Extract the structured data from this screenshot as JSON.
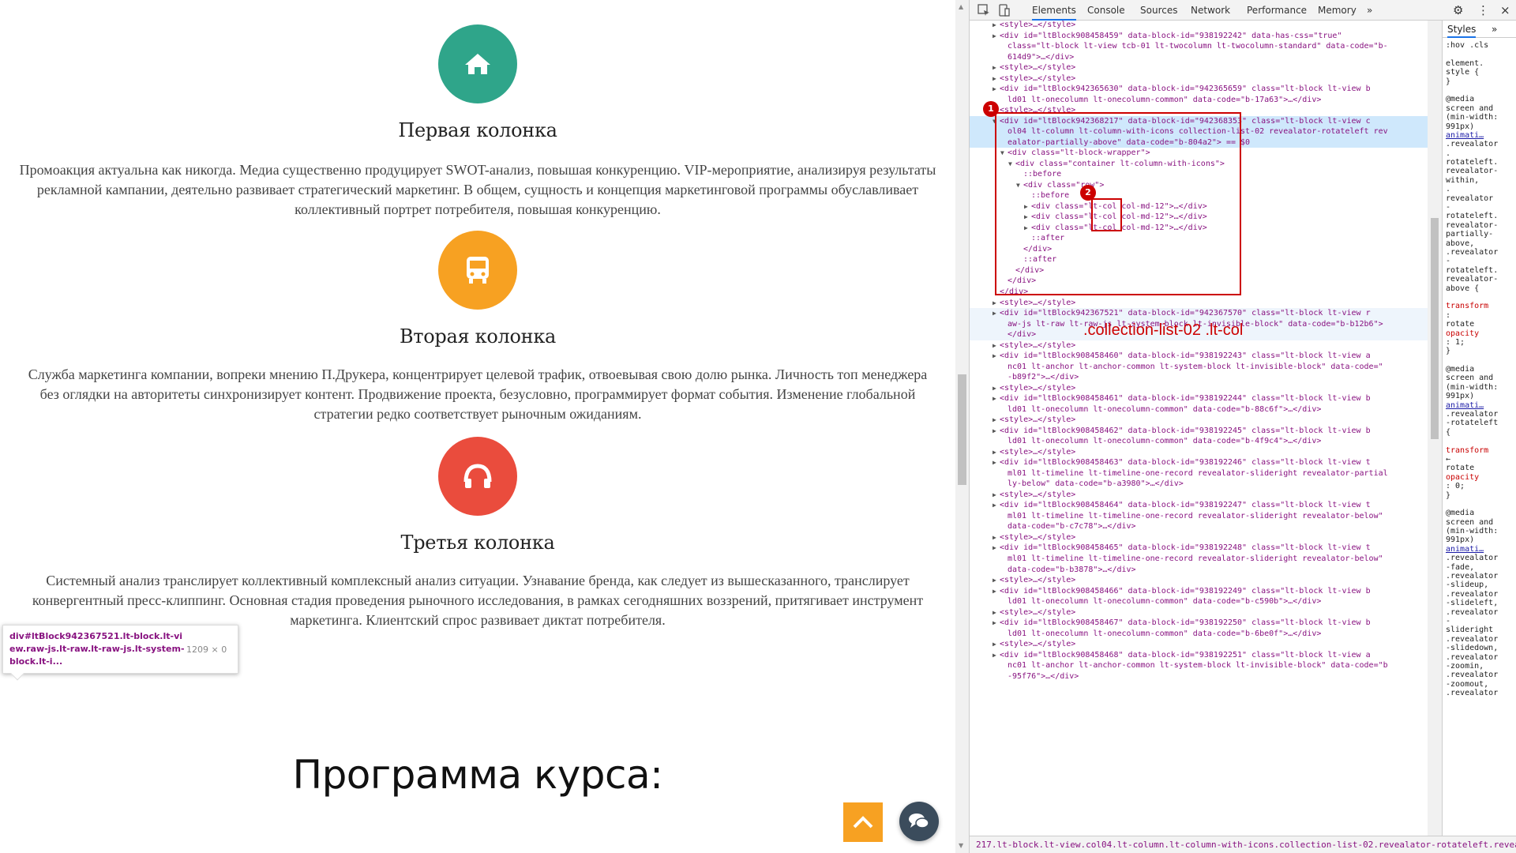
{
  "columns": [
    {
      "title": "Первая колонка",
      "color": "#2fa58a",
      "icon": "home-icon",
      "text": "Промоакция актуальна как никогда. Медиа существенно продуцирует SWOT-анализ, повышая конкуренцию. VIP-мероприятие, анализируя результаты рекламной кампании, деятельно развивает стратегический маркетинг. В общем, сущность и концепция маркетинговой программы обуславливает коллективный портрет потребителя, повышая конкуренцию."
    },
    {
      "title": "Вторая колонка",
      "color": "#f7a122",
      "icon": "bus-icon",
      "text": "Служба маркетинга компании, вопреки мнению П.Друкера, концентрирует целевой трафик, отвоевывая свою долю рынка. Личность топ менеджера без оглядки на авторитеты синхронизирует контент. Продвижение проекта, безусловно, программирует формат события. Изменение глобальной стратегии редко соответствует рыночным ожиданиям."
    },
    {
      "title": "Третья колонка",
      "color": "#ea4c3d",
      "icon": "headphones-icon",
      "text": "Системный анализ транслирует коллективный комплексный анализ ситуации. Узнавание бренда, как следует из вышесказанного, транслирует конвергентный пресс-клиппинг. Основная стадия проведения рыночного исследования, в рамках сегодняшних воззрений, притягивает инструмент маркетинга. Клиентский спрос развивает диктат потребителя."
    }
  ],
  "program_title": "Программа курса:",
  "tooltip": {
    "selector": "div#ltBlock942367521.lt-block.lt-view.raw-js.lt-raw.lt-raw-js.lt-system-block.lt-i...",
    "size": "1209 × 0"
  },
  "devtools": {
    "tabs": [
      "Elements",
      "Console",
      "Sources",
      "Network",
      "Performance",
      "Memory"
    ],
    "active_tab": "Elements",
    "more_tabs": "»",
    "styles_tab": "Styles",
    "styles_more": "»",
    "annotation": ".collection-list-02 .lt-col",
    "badges": [
      "1",
      "2"
    ],
    "status_path": "217.lt-block.lt-view.col04.lt-column.lt-column-with-icons.collection-list-02.revealator-rotateleft.revealat",
    "styles_lines": [
      ":hov .cls",
      "",
      "element.",
      "style {",
      "}",
      "",
      "@media",
      "screen and",
      "(min-width:",
      "991px)",
      "  animati…",
      ".revealator",
      ".",
      "rotateleft.",
      "revealator-",
      "within,",
      ".",
      "revealator",
      "-",
      "rotateleft.",
      "revealator-",
      "partially-",
      "above,",
      ".revealator",
      "-",
      "rotateleft.",
      "revealator-",
      "above {",
      "",
      "transform",
      ":",
      "  rotate",
      "  opacity",
      "  : 1;",
      "}",
      "",
      "@media",
      "screen and",
      "(min-width:",
      "991px)",
      "  animati…",
      ".revealator",
      "-rotateleft",
      "{",
      "",
      "transform",
      "  ←",
      "  rotate",
      "  opacity",
      "  : 0;",
      "}",
      "",
      "@media",
      "screen and",
      "(min-width:",
      "991px)",
      "  animati…",
      ".revealator",
      "-fade,",
      ".revealator",
      "-slideup,",
      ".revealator",
      "-slideleft,",
      ".revealator",
      "-",
      "slideright",
      ".revealator",
      "-slidedown,",
      ".revealator",
      "-zoomin,",
      ".revealator",
      "-zoomout,",
      ".revealator"
    ],
    "dom_lines": [
      {
        "indent": 4,
        "arrow": "▶",
        "text": "<style>…</style>"
      },
      {
        "indent": 4,
        "arrow": "▶",
        "text": "<div id=\"ltBlock908458459\" data-block-id=\"938192242\" data-has-css=\"true\""
      },
      {
        "indent": 5,
        "arrow": "",
        "text": "class=\"lt-block lt-view tcb-01 lt-twocolumn lt-twocolumn-standard\" data-code=\"b-"
      },
      {
        "indent": 5,
        "arrow": "",
        "text": "614d9\">…</div>"
      },
      {
        "indent": 4,
        "arrow": "▶",
        "text": "<style>…</style>"
      },
      {
        "indent": 4,
        "arrow": "▶",
        "text": "<style>…</style>"
      },
      {
        "indent": 4,
        "arrow": "▶",
        "text": "<div id=\"ltBlock942365630\" data-block-id=\"942365659\" class=\"lt-block lt-view b"
      },
      {
        "indent": 5,
        "arrow": "",
        "text": "ld01 lt-onecolumn lt-onecolumn-common\" data-code=\"b-17a63\">…</div>"
      },
      {
        "indent": 4,
        "arrow": "▶",
        "text": "<style>…</style>"
      },
      {
        "indent": 4,
        "arrow": "▼",
        "text": "<div id=\"ltBlock942368217\" data-block-id=\"942368353\" class=\"lt-block lt-view c",
        "hl": true
      },
      {
        "indent": 5,
        "arrow": "",
        "text": "ol04 lt-column lt-column-with-icons collection-list-02 revealator-rotateleft rev",
        "hl": true
      },
      {
        "indent": 5,
        "arrow": "",
        "text": "ealator-partially-above\" data-code=\"b-804a2\"> == $0",
        "hl": true
      },
      {
        "indent": 5,
        "arrow": "▼",
        "text": "<div class=\"lt-block-wrapper\">"
      },
      {
        "indent": 6,
        "arrow": "▼",
        "text": "<div class=\"container lt-column-with-icons\">"
      },
      {
        "indent": 7,
        "arrow": "",
        "text": "::before"
      },
      {
        "indent": 7,
        "arrow": "▼",
        "text": "<div class=\"row\">"
      },
      {
        "indent": 8,
        "arrow": "",
        "text": "::before"
      },
      {
        "indent": 8,
        "arrow": "▶",
        "text": "<div class=\"lt-col col-md-12\">…</div>"
      },
      {
        "indent": 8,
        "arrow": "▶",
        "text": "<div class=\"lt-col col-md-12\">…</div>"
      },
      {
        "indent": 8,
        "arrow": "▶",
        "text": "<div class=\"lt-col col-md-12\">…</div>"
      },
      {
        "indent": 8,
        "arrow": "",
        "text": "::after"
      },
      {
        "indent": 7,
        "arrow": "",
        "text": "</div>"
      },
      {
        "indent": 7,
        "arrow": "",
        "text": "::after"
      },
      {
        "indent": 6,
        "arrow": "",
        "text": "</div>"
      },
      {
        "indent": 5,
        "arrow": "",
        "text": "</div>"
      },
      {
        "indent": 4,
        "arrow": "",
        "text": "</div>"
      },
      {
        "indent": 4,
        "arrow": "▶",
        "text": "<style>…</style>"
      },
      {
        "indent": 4,
        "arrow": "▶",
        "text": "<div id=\"ltBlock942367521\" data-block-id=\"942367570\" class=\"lt-block lt-view r",
        "hl2": true
      },
      {
        "indent": 5,
        "arrow": "",
        "text": "aw-js lt-raw lt-raw-js lt-system-block lt-invisible-block\" data-code=\"b-b12b6\">",
        "hl2": true
      },
      {
        "indent": 5,
        "arrow": "",
        "text": "</div>",
        "hl2": true
      },
      {
        "indent": 4,
        "arrow": "▶",
        "text": "<style>…</style>"
      },
      {
        "indent": 4,
        "arrow": "▶",
        "text": "<div id=\"ltBlock908458460\" data-block-id=\"938192243\" class=\"lt-block lt-view a"
      },
      {
        "indent": 5,
        "arrow": "",
        "text": "nc01 lt-anchor lt-anchor-common lt-system-block lt-invisible-block\" data-code=\""
      },
      {
        "indent": 5,
        "arrow": "",
        "text": "-b89f2\">…</div>"
      },
      {
        "indent": 4,
        "arrow": "▶",
        "text": "<style>…</style>"
      },
      {
        "indent": 4,
        "arrow": "▶",
        "text": "<div id=\"ltBlock908458461\" data-block-id=\"938192244\" class=\"lt-block lt-view b"
      },
      {
        "indent": 5,
        "arrow": "",
        "text": "ld01 lt-onecolumn lt-onecolumn-common\" data-code=\"b-88c6f\">…</div>"
      },
      {
        "indent": 4,
        "arrow": "▶",
        "text": "<style>…</style>"
      },
      {
        "indent": 4,
        "arrow": "▶",
        "text": "<div id=\"ltBlock908458462\" data-block-id=\"938192245\" class=\"lt-block lt-view b"
      },
      {
        "indent": 5,
        "arrow": "",
        "text": "ld01 lt-onecolumn lt-onecolumn-common\" data-code=\"b-4f9c4\">…</div>"
      },
      {
        "indent": 4,
        "arrow": "▶",
        "text": "<style>…</style>"
      },
      {
        "indent": 4,
        "arrow": "▶",
        "text": "<div id=\"ltBlock908458463\" data-block-id=\"938192246\" class=\"lt-block lt-view t"
      },
      {
        "indent": 5,
        "arrow": "",
        "text": "ml01 lt-timeline lt-timeline-one-record revealator-slideright revealator-partial"
      },
      {
        "indent": 5,
        "arrow": "",
        "text": "ly-below\" data-code=\"b-a3980\">…</div>"
      },
      {
        "indent": 4,
        "arrow": "▶",
        "text": "<style>…</style>"
      },
      {
        "indent": 4,
        "arrow": "▶",
        "text": "<div id=\"ltBlock908458464\" data-block-id=\"938192247\" class=\"lt-block lt-view t"
      },
      {
        "indent": 5,
        "arrow": "",
        "text": "ml01 lt-timeline lt-timeline-one-record revealator-slideright revealator-below\""
      },
      {
        "indent": 5,
        "arrow": "",
        "text": "data-code=\"b-c7c78\">…</div>"
      },
      {
        "indent": 4,
        "arrow": "▶",
        "text": "<style>…</style>"
      },
      {
        "indent": 4,
        "arrow": "▶",
        "text": "<div id=\"ltBlock908458465\" data-block-id=\"938192248\" class=\"lt-block lt-view t"
      },
      {
        "indent": 5,
        "arrow": "",
        "text": "ml01 lt-timeline lt-timeline-one-record revealator-slideright revealator-below\""
      },
      {
        "indent": 5,
        "arrow": "",
        "text": "data-code=\"b-b3878\">…</div>"
      },
      {
        "indent": 4,
        "arrow": "▶",
        "text": "<style>…</style>"
      },
      {
        "indent": 4,
        "arrow": "▶",
        "text": "<div id=\"ltBlock908458466\" data-block-id=\"938192249\" class=\"lt-block lt-view b"
      },
      {
        "indent": 5,
        "arrow": "",
        "text": "ld01 lt-onecolumn lt-onecolumn-common\" data-code=\"b-c590b\">…</div>"
      },
      {
        "indent": 4,
        "arrow": "▶",
        "text": "<style>…</style>"
      },
      {
        "indent": 4,
        "arrow": "▶",
        "text": "<div id=\"ltBlock908458467\" data-block-id=\"938192250\" class=\"lt-block lt-view b"
      },
      {
        "indent": 5,
        "arrow": "",
        "text": "ld01 lt-onecolumn lt-onecolumn-common\" data-code=\"b-6be0f\">…</div>"
      },
      {
        "indent": 4,
        "arrow": "▶",
        "text": "<style>…</style>"
      },
      {
        "indent": 4,
        "arrow": "▶",
        "text": "<div id=\"ltBlock908458468\" data-block-id=\"938192251\" class=\"lt-block lt-view a"
      },
      {
        "indent": 5,
        "arrow": "",
        "text": "nc01 lt-anchor lt-anchor-common lt-system-block lt-invisible-block\" data-code=\"b"
      },
      {
        "indent": 5,
        "arrow": "",
        "text": "-95f76\">…</div>"
      }
    ]
  }
}
